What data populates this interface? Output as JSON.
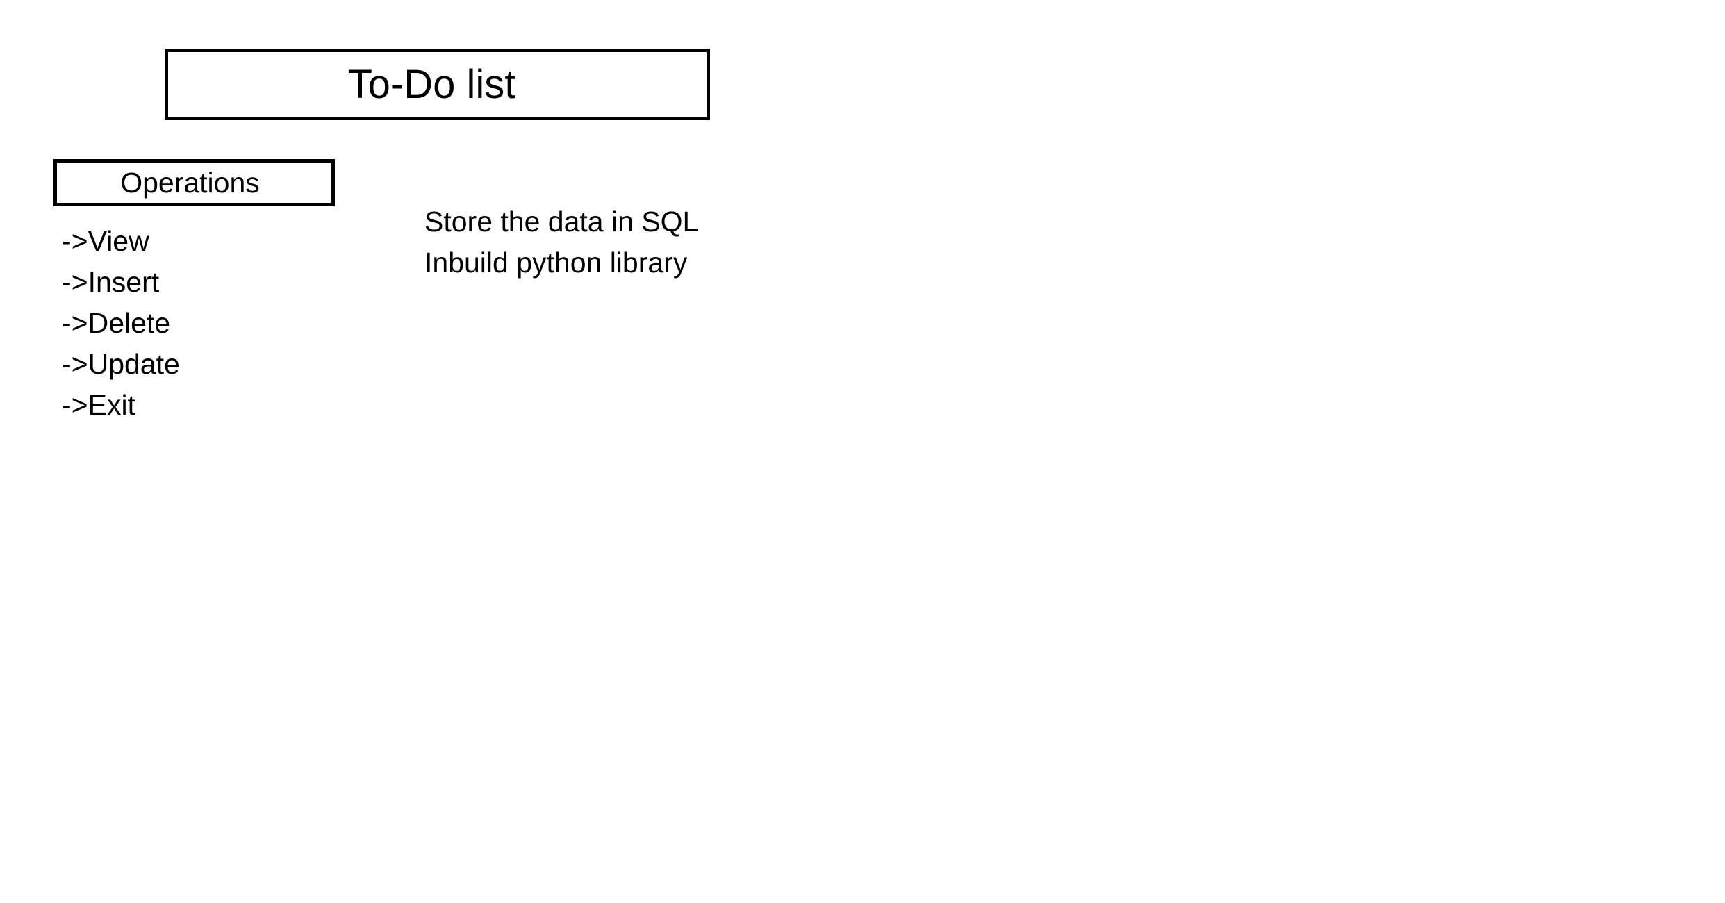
{
  "title": "To-Do list",
  "operations": {
    "heading": "Operations",
    "items": [
      {
        "label": "->View"
      },
      {
        "label": "->Insert"
      },
      {
        "label": "->Delete"
      },
      {
        "label": "->Update"
      },
      {
        "label": "->Exit"
      }
    ]
  },
  "notes": {
    "line1": "Store the data in SQL",
    "line2": "Inbuild python library"
  }
}
